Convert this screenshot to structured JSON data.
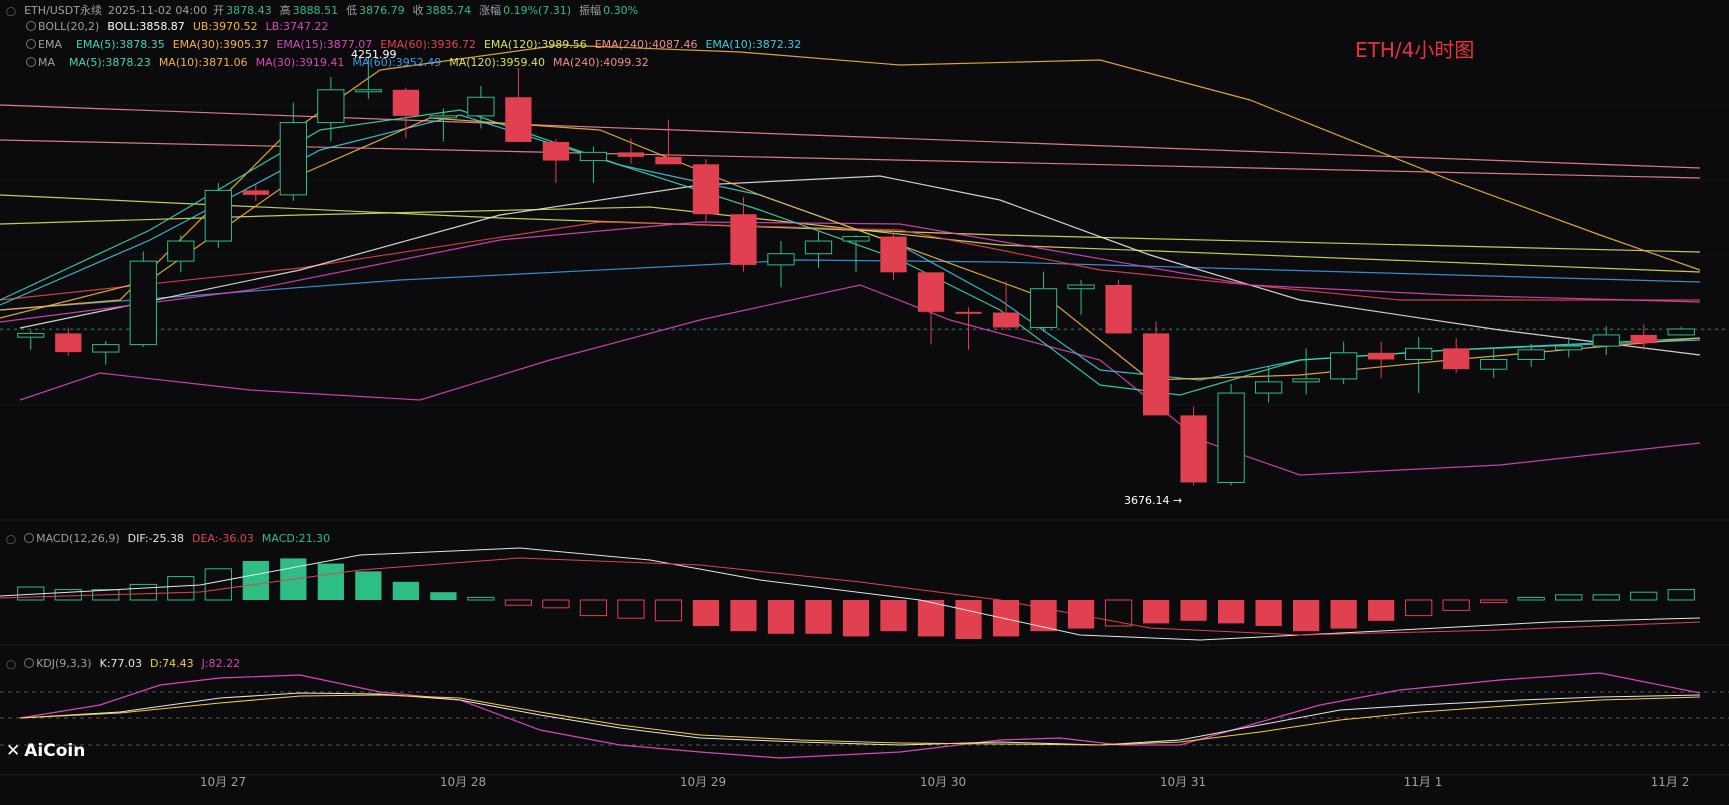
{
  "title_annotation": "ETH/4小时图",
  "header": {
    "symbol": "ETH/USDT永续",
    "datetime": "2025-11-02 04:00",
    "open_label": "开",
    "open": "3878.43",
    "high_label": "高",
    "high": "3888.51",
    "low_label": "低",
    "low": "3876.79",
    "close_label": "收",
    "close": "3885.74",
    "change_label": "涨幅",
    "change": "0.19%(7.31)",
    "amplitude_label": "振幅",
    "amplitude": "0.30%"
  },
  "boll": {
    "name": "BOLL(20,2)",
    "boll": "BOLL:3858.87",
    "ub": "UB:3970.52",
    "lb": "LB:3747.22"
  },
  "ema": {
    "name": "EMA",
    "items": [
      "EMA(5):3878.35",
      "EMA(30):3905.37",
      "EMA(15):3877.07",
      "EMA(60):3936.72",
      "EMA(120):3989.56",
      "EMA(240):4087.46",
      "EMA(10):3872.32"
    ]
  },
  "ma": {
    "name": "MA",
    "items": [
      "MA(5):3878.23",
      "MA(10):3871.06",
      "MA(30):3919.41",
      "MA(60):3952.49",
      "MA(120):3959.40",
      "MA(240):4099.32"
    ]
  },
  "macd": {
    "name": "MACD(12,26,9)",
    "dif": "DIF:-25.38",
    "dea": "DEA:-36.03",
    "macd": "MACD:21.30"
  },
  "kdj": {
    "name": "KDJ(9,3,3)",
    "k": "K:77.03",
    "d": "D:74.43",
    "j": "J:82.22"
  },
  "annotations": {
    "high_mark": "4251.99",
    "low_mark": "3676.14 →"
  },
  "logo": "AiCoin",
  "colors": {
    "up": "#2ebd85",
    "down": "#e04050",
    "background": "#0b0b0d",
    "title": "#e8333a"
  },
  "chart_data": {
    "type": "candlestick",
    "x_ticks": [
      "10月 27",
      "10月 28",
      "10月 29",
      "10月 30",
      "10月 31",
      "11月 1",
      "11月 2"
    ],
    "candles": [
      {
        "o": 3875,
        "h": 3884,
        "l": 3858,
        "c": 3880
      },
      {
        "o": 3880,
        "h": 3888,
        "l": 3850,
        "c": 3855
      },
      {
        "o": 3855,
        "h": 3870,
        "l": 3838,
        "c": 3865
      },
      {
        "o": 3865,
        "h": 3990,
        "l": 3862,
        "c": 3977
      },
      {
        "o": 3977,
        "h": 4012,
        "l": 3962,
        "c": 4004
      },
      {
        "o": 4004,
        "h": 4082,
        "l": 3995,
        "c": 4072
      },
      {
        "o": 4072,
        "h": 4080,
        "l": 4058,
        "c": 4066
      },
      {
        "o": 4066,
        "h": 4190,
        "l": 4058,
        "c": 4163
      },
      {
        "o": 4163,
        "h": 4224,
        "l": 4138,
        "c": 4207
      },
      {
        "o": 4207,
        "h": 4252,
        "l": 4195,
        "c": 4207
      },
      {
        "o": 4207,
        "h": 4210,
        "l": 4142,
        "c": 4172
      },
      {
        "o": 4172,
        "h": 4182,
        "l": 4138,
        "c": 4172
      },
      {
        "o": 4172,
        "h": 4212,
        "l": 4155,
        "c": 4197
      },
      {
        "o": 4197,
        "h": 4236,
        "l": 4143,
        "c": 4137
      },
      {
        "o": 4137,
        "h": 4141,
        "l": 4082,
        "c": 4112
      },
      {
        "o": 4112,
        "h": 4131,
        "l": 4082,
        "c": 4123
      },
      {
        "o": 4123,
        "h": 4142,
        "l": 4108,
        "c": 4117
      },
      {
        "o": 4117,
        "h": 4167,
        "l": 4108,
        "c": 4107
      },
      {
        "o": 4107,
        "h": 4114,
        "l": 4029,
        "c": 4040
      },
      {
        "o": 4040,
        "h": 4063,
        "l": 3963,
        "c": 3972
      },
      {
        "o": 3972,
        "h": 4004,
        "l": 3942,
        "c": 3987
      },
      {
        "o": 3987,
        "h": 4017,
        "l": 3968,
        "c": 4004
      },
      {
        "o": 4004,
        "h": 4012,
        "l": 3962,
        "c": 4010
      },
      {
        "o": 4010,
        "h": 4020,
        "l": 3952,
        "c": 3962
      },
      {
        "o": 3962,
        "h": 3961,
        "l": 3865,
        "c": 3909
      },
      {
        "o": 3909,
        "h": 3915,
        "l": 3858,
        "c": 3908
      },
      {
        "o": 3908,
        "h": 3950,
        "l": 3885,
        "c": 3888
      },
      {
        "o": 3888,
        "h": 3963,
        "l": 3882,
        "c": 3940
      },
      {
        "o": 3940,
        "h": 3952,
        "l": 3905,
        "c": 3945
      },
      {
        "o": 3945,
        "h": 3952,
        "l": 3890,
        "c": 3880
      },
      {
        "o": 3880,
        "h": 3896,
        "l": 3800,
        "c": 3770
      },
      {
        "o": 3770,
        "h": 3782,
        "l": 3676,
        "c": 3680
      },
      {
        "o": 3680,
        "h": 3812,
        "l": 3676,
        "c": 3800
      },
      {
        "o": 3800,
        "h": 3836,
        "l": 3787,
        "c": 3815
      },
      {
        "o": 3815,
        "h": 3860,
        "l": 3798,
        "c": 3819
      },
      {
        "o": 3819,
        "h": 3869,
        "l": 3812,
        "c": 3854
      },
      {
        "o": 3854,
        "h": 3869,
        "l": 3820,
        "c": 3845
      },
      {
        "o": 3845,
        "h": 3875,
        "l": 3800,
        "c": 3860
      },
      {
        "o": 3860,
        "h": 3874,
        "l": 3827,
        "c": 3832
      },
      {
        "o": 3832,
        "h": 3860,
        "l": 3820,
        "c": 3845
      },
      {
        "o": 3845,
        "h": 3866,
        "l": 3835,
        "c": 3858
      },
      {
        "o": 3858,
        "h": 3875,
        "l": 3848,
        "c": 3863
      },
      {
        "o": 3863,
        "h": 3890,
        "l": 3851,
        "c": 3878
      },
      {
        "o": 3878,
        "h": 3892,
        "l": 3858,
        "c": 3867
      },
      {
        "o": 3878,
        "h": 3889,
        "l": 3877,
        "c": 3886
      }
    ],
    "macd_hist": [
      5,
      4,
      4,
      6,
      9,
      12,
      15,
      16,
      14,
      11,
      7,
      3,
      1,
      -2,
      -3,
      -6,
      -7,
      -8,
      -10,
      -12,
      -13,
      -13,
      -14,
      -12,
      -14,
      -15,
      -14,
      -12,
      -11,
      -10,
      -9,
      -8,
      -9,
      -10,
      -12,
      -11,
      -8,
      -6,
      -4,
      -1,
      1,
      2,
      2,
      3,
      4
    ],
    "y_ref_price": 3885.74
  }
}
